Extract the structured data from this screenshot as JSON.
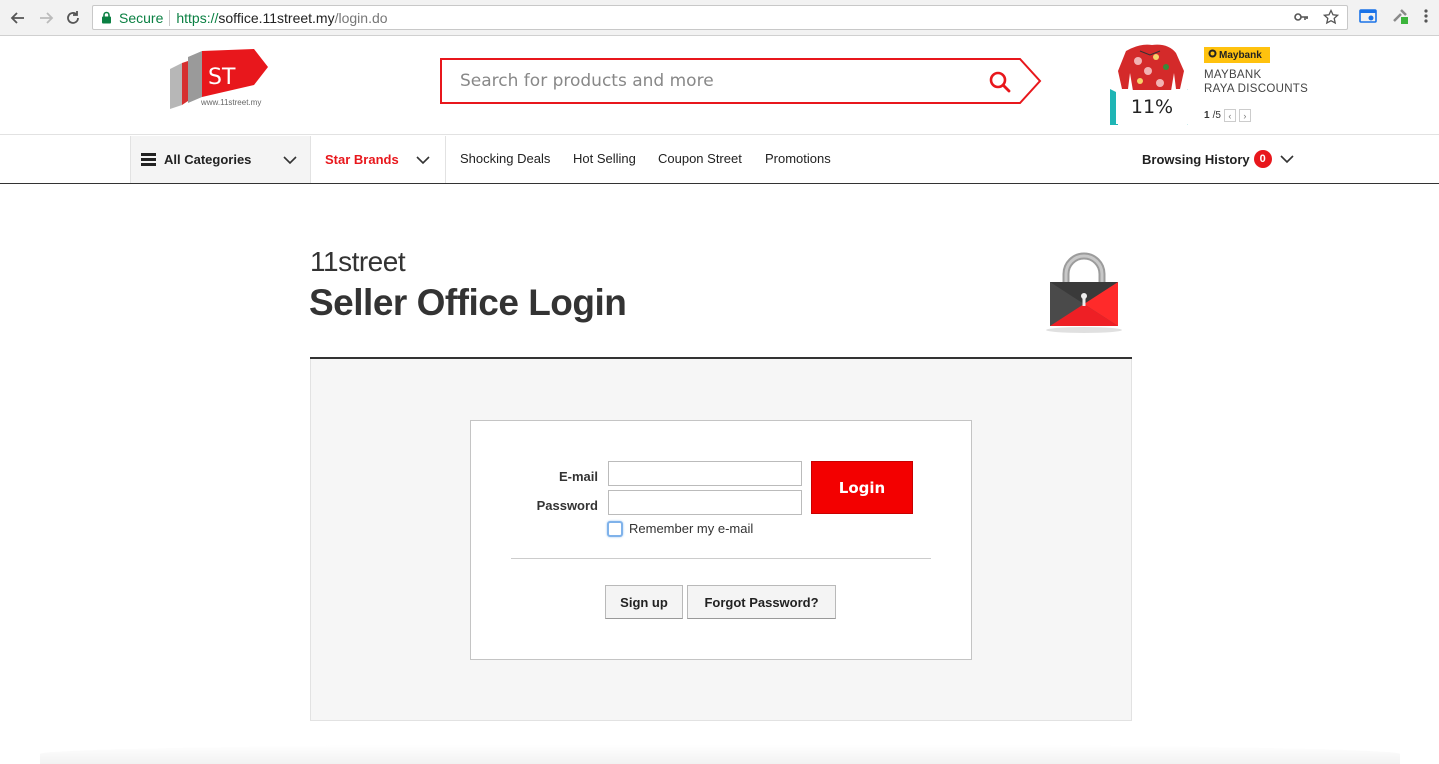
{
  "browser": {
    "secure_label": "Secure",
    "url_scheme": "https://",
    "url_host": "soffice.11street.my",
    "url_path": "/login.do"
  },
  "header": {
    "logo_text": "ST",
    "logo_url": "www.11street.my",
    "search_placeholder": "Search for products and more",
    "promo": {
      "percent": "11%",
      "badge": "Maybank",
      "line1": "MAYBANK",
      "line2": "RAYA DISCOUNTS",
      "page_current": "1",
      "page_total": "/5",
      "prev": "‹",
      "next": "›"
    }
  },
  "nav": {
    "all_categories": "All Categories",
    "star_brands": "Star Brands",
    "links": [
      "Shocking Deals",
      "Hot Selling",
      "Coupon Street",
      "Promotions"
    ],
    "browsing_history": "Browsing History",
    "history_count": "0"
  },
  "login": {
    "brand": "11street",
    "title": "Seller Office Login",
    "email_label": "E-mail",
    "password_label": "Password",
    "email_value": "",
    "password_value": "",
    "login_button": "Login",
    "remember_label": "Remember my e-mail",
    "signup_button": "Sign up",
    "forgot_button": "Forgot Password?"
  },
  "colors": {
    "brand_red": "#e8171c",
    "login_red": "#f30000",
    "secure_green": "#0b8043",
    "maybank_yellow": "#ffc20e"
  }
}
